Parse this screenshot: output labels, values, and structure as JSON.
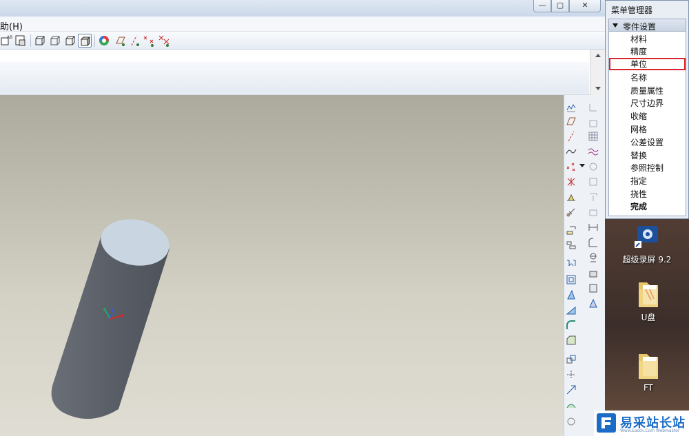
{
  "menubar": {
    "help_label": "助(H)"
  },
  "menu_manager": {
    "title": "菜单管理器",
    "section": "零件设置",
    "items": [
      "材料",
      "精度",
      "单位",
      "名称",
      "质量属性",
      "尺寸边界",
      "收缩",
      "网格",
      "公差设置",
      "替换",
      "参照控制",
      "指定",
      "挠性",
      "完成"
    ],
    "highlighted": "单位"
  },
  "desktop": {
    "icons": [
      {
        "label": "超级录屏 9.2",
        "icon": "screen-recorder-icon"
      },
      {
        "label": "U盘",
        "icon": "folder-icon"
      },
      {
        "label": "FT",
        "icon": "folder-icon"
      }
    ]
  },
  "watermark": {
    "text": "易采站长站",
    "sub": "Www.Easck.Com Webmaster"
  },
  "colors": {
    "viewport_top": "#acaa9d",
    "viewport_bottom": "#e0ddd4",
    "model_body": "#5d626a",
    "model_top": "#c9d6e1",
    "highlight_box": "#d6262f"
  }
}
